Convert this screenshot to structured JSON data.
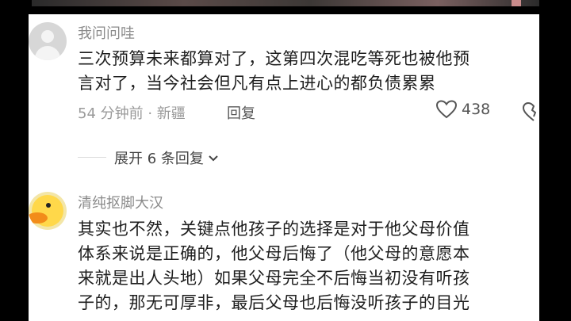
{
  "comments": [
    {
      "username": "我问问哇",
      "lines": [
        "三次预算未来都算对了，这第四次混吃等死也被他预",
        "言对了，当今社会但凡有点上进心的都负债累累"
      ],
      "time_location": "54 分钟前 · 新疆",
      "reply_label": "回复",
      "likes": "438",
      "expand_label": "展开 6 条回复",
      "avatar_icon": "default-avatar-icon"
    },
    {
      "username": "清纯抠脚大汉",
      "lines": [
        "其实也不然，关键点他孩子的选择是对于他父母价值",
        "体系来说是正确的，他父母后悔了（他父母的意愿本",
        "来就是出人头地）如果父母完全不后悔当初没有听孩",
        "子的，那无可厚非，最后父母也后悔没听孩子的目光"
      ],
      "avatar_icon": "duck-avatar-icon"
    }
  ],
  "colors": {
    "accent": "#1e1e1e",
    "muted": "#9a9a9a",
    "panel": "#ffffff"
  }
}
